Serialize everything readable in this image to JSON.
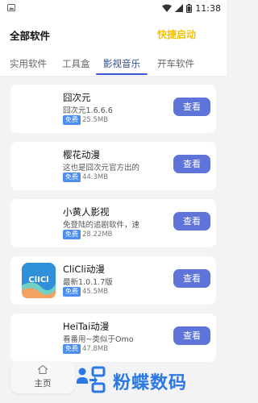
{
  "status_bar": {
    "time": "11:38",
    "icons": [
      "image-icon",
      "wifi-icon",
      "signal-icon",
      "battery-icon"
    ]
  },
  "header": {
    "title": "全部软件",
    "action": "快捷启动",
    "action_color": "#f2c300"
  },
  "tabs": [
    {
      "label": "实用软件",
      "active": false
    },
    {
      "label": "工具盒",
      "active": false
    },
    {
      "label": "影视音乐",
      "active": true
    },
    {
      "label": "开车软件",
      "active": false
    }
  ],
  "apps": [
    {
      "name": "囧次元",
      "desc": "囧次元1.6.6.6",
      "badge": "免费",
      "size": "25.5MB",
      "button": "查看",
      "icon": "blank-icon"
    },
    {
      "name": "樱花动漫",
      "desc": "这也是囧次元官方出的",
      "badge": "免费",
      "size": "44.3MB",
      "button": "查看",
      "icon": "blank-icon"
    },
    {
      "name": "小黄人影视",
      "desc": "免登陆的追剧软件，速",
      "badge": "免费",
      "size": "28.22MB",
      "button": "查看",
      "icon": "blank-icon"
    },
    {
      "name": "CliCli动漫",
      "desc": "最新1.0.1.7版",
      "badge": "免费",
      "size": "45.5MB",
      "button": "查看",
      "icon": "clicli-logo-icon"
    },
    {
      "name": "HeiTai动漫",
      "desc": "看番用~类似于Omo",
      "badge": "免费",
      "size": "47.8MB",
      "button": "查看",
      "icon": "blank-icon"
    }
  ],
  "bottom_nav": {
    "home_label": "主页"
  },
  "watermark": {
    "text": "粉蝶数码"
  },
  "colors": {
    "button_bg": "#5e74d9",
    "badge_bg": "#4c8df0",
    "tab_active": "#2b4c96",
    "watermark": "#2b78e4"
  }
}
